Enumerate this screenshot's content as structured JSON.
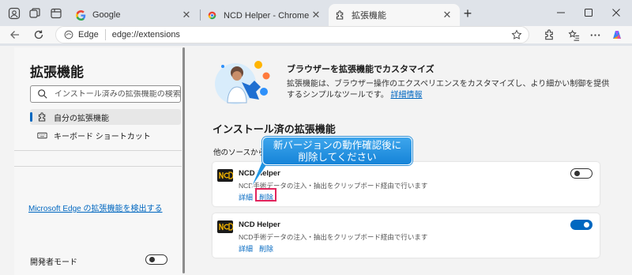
{
  "tabs": [
    {
      "title": "Google",
      "active": false
    },
    {
      "title": "NCD Helper - Chrome ウェブストア",
      "active": false
    },
    {
      "title": "拡張機能",
      "active": true
    }
  ],
  "address_bar": {
    "brand": "Edge",
    "url": "edge://extensions"
  },
  "sidebar": {
    "heading": "拡張機能",
    "search_placeholder": "インストール済みの拡張機能の検索",
    "items": [
      {
        "label": "自分の拡張機能",
        "active": true
      },
      {
        "label": "キーボード ショートカット",
        "active": false
      }
    ],
    "discover_link": "Microsoft Edge の拡張機能を検出する",
    "dev_mode_label": "開発者モード",
    "dev_mode_on": false
  },
  "hero": {
    "title": "ブラウザーを拡張機能でカスタマイズ",
    "description": "拡張機能は、ブラウザー操作のエクスペリエンスをカスタマイズし、より細かい制御を提供するシンプルなツールです。",
    "details_link": "詳細情報"
  },
  "section": {
    "title": "インストール済の拡張機能",
    "subtitle": "他のソースから"
  },
  "extensions": [
    {
      "name": "NCD Helper",
      "description": "NCD手術データの注入・抽出をクリップボード経由で行います",
      "details_label": "詳細",
      "remove_label": "削除",
      "enabled": false
    },
    {
      "name": "NCD Helper",
      "description": "NCD手術データの注入・抽出をクリップボード経由で行います",
      "details_label": "詳細",
      "remove_label": "削除",
      "enabled": true
    }
  ],
  "callout": {
    "line1": "新バージョンの動作確認後に",
    "line2": "削除してください"
  },
  "colors": {
    "accent": "#0067c0",
    "highlight": "#e2245c",
    "callout": "#2196e3"
  }
}
